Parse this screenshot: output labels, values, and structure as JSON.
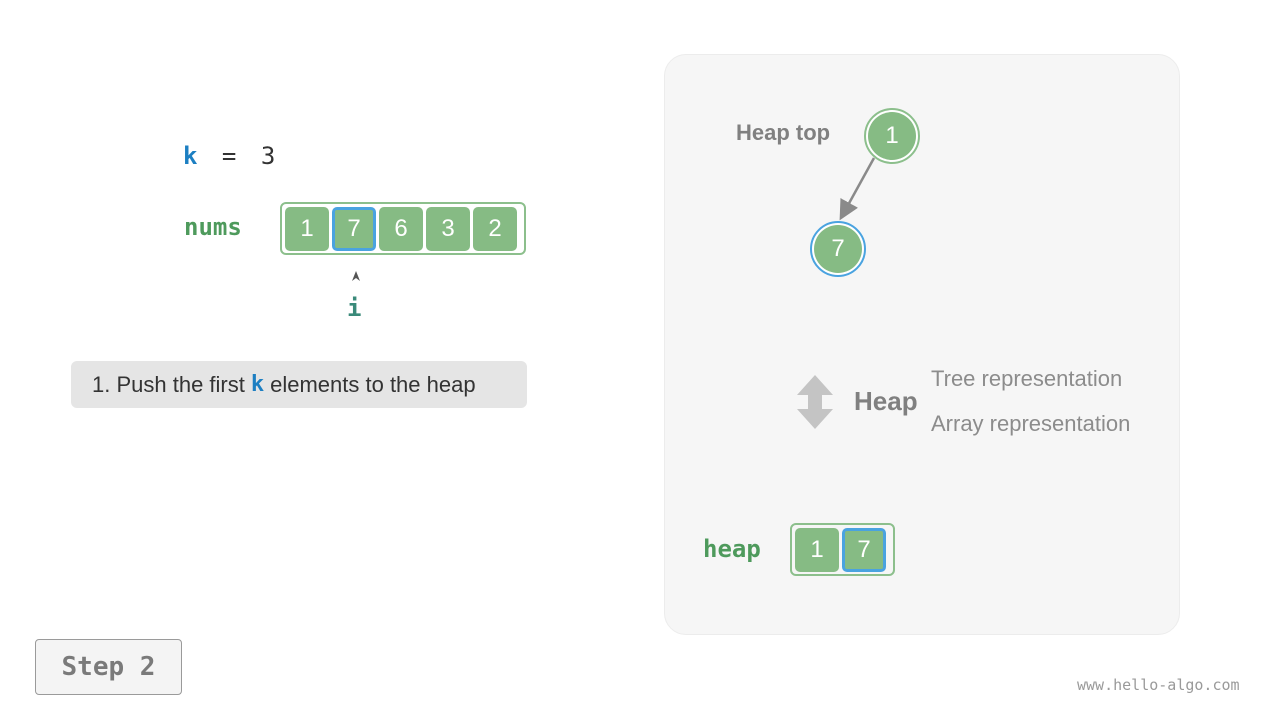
{
  "k_line": {
    "var": "k",
    "equals": "=",
    "value": "3"
  },
  "nums": {
    "label": "nums",
    "values": [
      "1",
      "7",
      "6",
      "3",
      "2"
    ],
    "highlight_index": 1
  },
  "pointer": {
    "label": "i"
  },
  "caption": {
    "prefix": "1. Push the first",
    "keyword": "k",
    "suffix": "elements to the heap"
  },
  "tree": {
    "top_label": "Heap top",
    "nodes": [
      "1",
      "7"
    ]
  },
  "heap_rep": {
    "heap_word": "Heap",
    "tree_rep": "Tree representation",
    "array_rep": "Array representation"
  },
  "heap_array": {
    "label": "heap",
    "values": [
      "1",
      "7"
    ],
    "highlight_index": 1
  },
  "step": "Step 2",
  "watermark": "www.hello-algo.com",
  "colors": {
    "node_fill": "#86bb84",
    "node_ring": "#8cbf8c",
    "highlight": "#4aa3e0",
    "keyword": "#1d7fc2",
    "label_green": "#4e9a5c"
  }
}
